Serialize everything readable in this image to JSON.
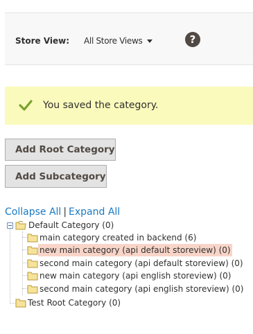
{
  "store_switcher": {
    "label": "Store View:",
    "selected": "All Store Views",
    "help_icon": "question-circle-icon",
    "help_glyph": "?"
  },
  "message": {
    "icon": "checkmark-icon",
    "text": "You saved the category.",
    "color": "#79a22e",
    "background": "#fafabc"
  },
  "buttons": {
    "add_root": "Add Root Category",
    "add_sub": "Add Subcategory"
  },
  "tree_controls": {
    "collapse_all": "Collapse All",
    "separator": "|",
    "expand_all": "Expand All"
  },
  "tree": {
    "root": {
      "label": "Default Category (0)",
      "expanded": true
    },
    "children": [
      {
        "label": "main category created in backend (6)",
        "selected": false
      },
      {
        "label": "new main category (api default storeview) (0)",
        "selected": true
      },
      {
        "label": "second main category (api default storeview) (0)",
        "selected": false
      },
      {
        "label": "new main category (api english storeview) (0)",
        "selected": false
      },
      {
        "label": "second main category (api english storeview) (0)",
        "selected": false
      }
    ],
    "second_root": {
      "label": "Test Root Category (0)"
    },
    "selected_color": "#f8d5c8"
  }
}
